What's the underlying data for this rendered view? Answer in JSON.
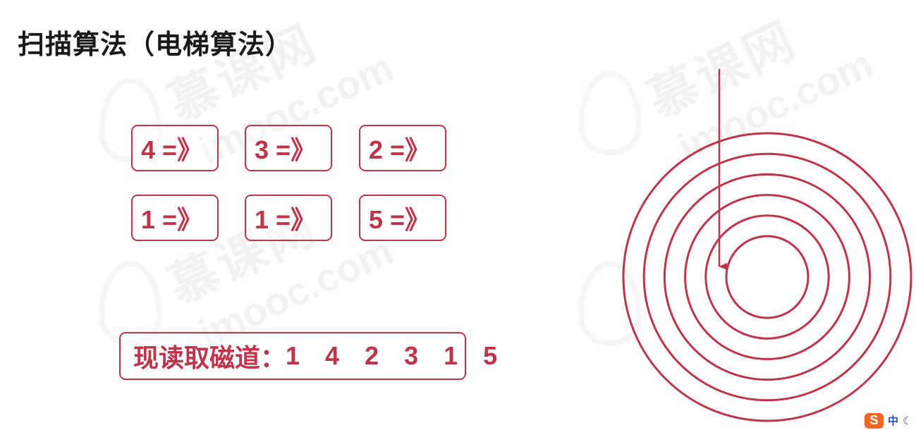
{
  "page": {
    "title": "扫描算法（电梯算法）"
  },
  "watermark": {
    "cn": "慕课网",
    "en": "imooc.com"
  },
  "requests": [
    {
      "label": "4 =》"
    },
    {
      "label": "3 =》"
    },
    {
      "label": "2 =》"
    },
    {
      "label": "1 =》"
    },
    {
      "label": "1 =》"
    },
    {
      "label": "5 =》"
    }
  ],
  "sequence": {
    "label": "现读取磁道：",
    "values": "1 4 2 3 1 5"
  },
  "disk": {
    "track_count": 6,
    "color": "#c0344a"
  },
  "ime": {
    "logo": "S",
    "lang": "中",
    "mode_icon": "moon-icon"
  },
  "colors": {
    "accent": "#c0344a",
    "title": "#1a1a1a"
  }
}
